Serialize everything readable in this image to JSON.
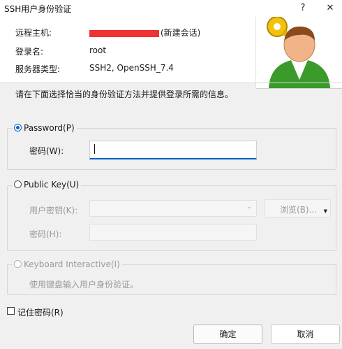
{
  "window": {
    "title": "SSH用户身份验证",
    "help_label": "?",
    "close_label": "✕"
  },
  "info": {
    "host_label": "远程主机:",
    "host_value_suffix": "(新建会话)",
    "login_label": "登录名:",
    "login_value": "root",
    "server_type_label": "服务器类型:",
    "server_type_value": "SSH2, OpenSSH_7.4"
  },
  "prompt": "请在下面选择恰当的身份验证方法并提供登录所需的信息。",
  "password_group": {
    "radio_label": "Password(P)",
    "checked": true,
    "field_label": "密码(W):",
    "field_value": ""
  },
  "publickey_group": {
    "radio_label": "Public Key(U)",
    "key_label": "用户密钥(K):",
    "key_value": "",
    "browse_label": "浏览(B)...",
    "pass_label": "密码(H):",
    "pass_value": ""
  },
  "keyboard_group": {
    "radio_label": "Keyboard Interactive(I)",
    "description": "使用键盘输入用户身份验证。"
  },
  "remember": {
    "label": "记住密码(R)",
    "checked": false
  },
  "buttons": {
    "ok": "确定",
    "cancel": "取消"
  },
  "colors": {
    "accent": "#0b62c4",
    "redacted": "#ee3333"
  }
}
